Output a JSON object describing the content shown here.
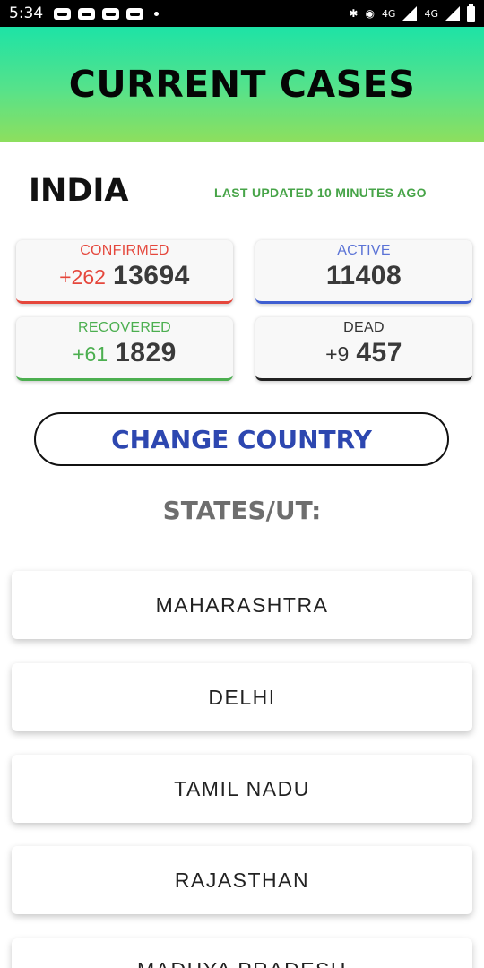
{
  "status_bar": {
    "time": "5:34",
    "net_1": "4G",
    "net_2": "4G"
  },
  "header": {
    "title": "CURRENT CASES"
  },
  "country": {
    "name": "INDIA",
    "last_updated": "LAST UPDATED 10 MINUTES AGO"
  },
  "stats": {
    "confirmed": {
      "label": "CONFIRMED",
      "delta": "+262",
      "value": "13694",
      "color": "#e5473c"
    },
    "active": {
      "label": "ACTIVE",
      "value": "11408",
      "color": "#5b73d6"
    },
    "recovered": {
      "label": "RECOVERED",
      "delta": "+61",
      "value": "1829",
      "color": "#4caf50"
    },
    "dead": {
      "label": "DEAD",
      "delta": "+9",
      "value": "457",
      "color": "#333333"
    }
  },
  "change_country_label": "CHANGE COUNTRY",
  "states_heading": "STATES/UT:",
  "states": [
    "MAHARASHTRA",
    "DELHI",
    "TAMIL NADU",
    "RAJASTHAN",
    "MADHYA PRADESH"
  ]
}
